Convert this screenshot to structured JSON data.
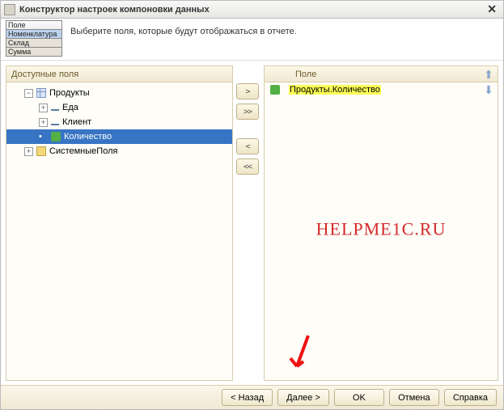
{
  "window": {
    "title": "Конструктор настроек компоновки данных"
  },
  "tabs": {
    "header": "Поле",
    "items": [
      "Номенклатура",
      "Склад",
      "Сумма"
    ]
  },
  "instruction": "Выберите поля, которые будут отображаться в отчете.",
  "leftHeader": "Доступные поля",
  "tree": {
    "root": "Продукты",
    "children": [
      "Еда",
      "Клиент",
      "Количество"
    ],
    "extra": "СистемныеПоля"
  },
  "moveButtons": {
    "add": ">",
    "addAll": ">>",
    "remove": "<",
    "removeAll": "<<"
  },
  "rightHeader": {
    "col1": "",
    "col2": "Поле"
  },
  "selected": {
    "label": "Продукты.Количество"
  },
  "watermark": "HELPME1C.RU",
  "footer": {
    "back": "< Назад",
    "next": "Далее >",
    "ok": "OK",
    "cancel": "Отмена",
    "help": "Справка"
  }
}
